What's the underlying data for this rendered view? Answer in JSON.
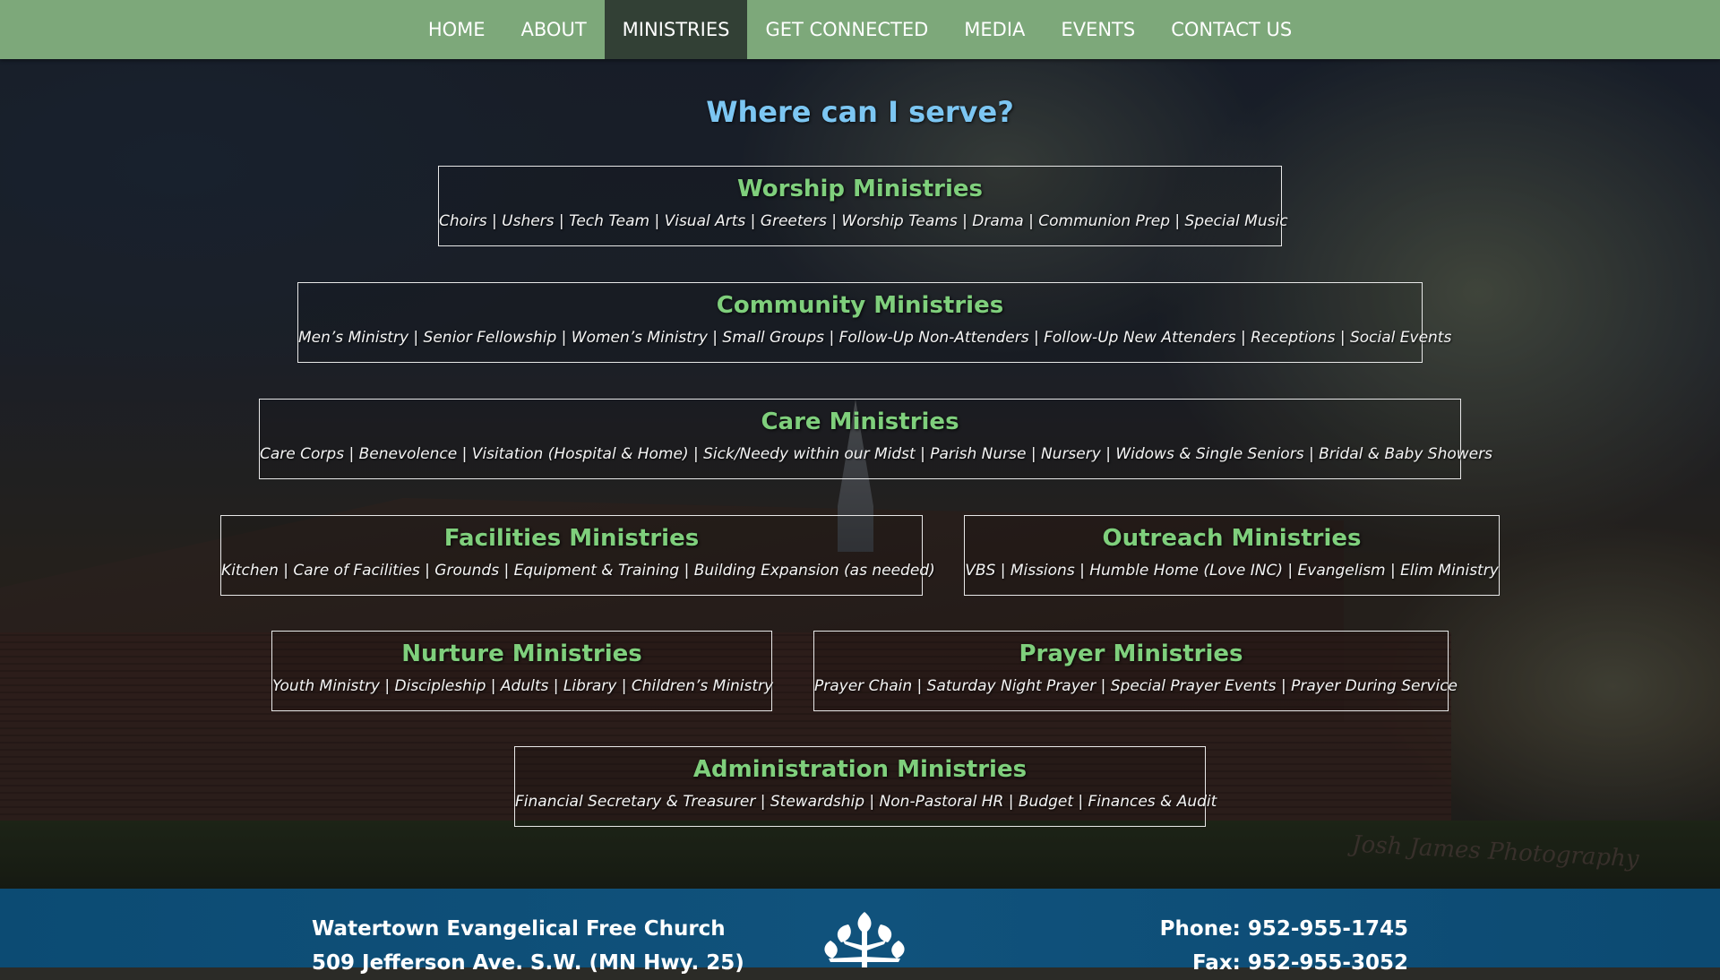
{
  "nav": {
    "items": [
      {
        "label": "HOME"
      },
      {
        "label": "ABOUT"
      },
      {
        "label": "MINISTRIES"
      },
      {
        "label": "GET CONNECTED"
      },
      {
        "label": "MEDIA"
      },
      {
        "label": "EVENTS"
      },
      {
        "label": "CONTACT US"
      }
    ],
    "active": "MINISTRIES"
  },
  "headline": "Where can I serve?",
  "ministries": [
    {
      "title": "Worship Ministries",
      "items": "Choirs | Ushers | Tech Team | Visual Arts | Greeters | Worship Teams | Drama | Communion Prep | Special Music"
    },
    {
      "title": "Community Ministries",
      "items": "Men’s Ministry | Senior Fellowship | Women’s Ministry | Small Groups | Follow-Up Non-Attenders | Follow-Up New Attenders | Receptions | Social Events"
    },
    {
      "title": "Care Ministries",
      "items": "Care Corps | Benevolence | Visitation (Hospital & Home) | Sick/Needy within our Midst | Parish Nurse | Nursery | Widows & Single Seniors | Bridal & Baby Showers"
    },
    {
      "title": "Facilities Ministries",
      "items": "Kitchen | Care of Facilities | Grounds | Equipment & Training | Building Expansion (as needed)"
    },
    {
      "title": "Outreach Ministries",
      "items": "VBS | Missions | Humble Home (Love INC) | Evangelism | Elim Ministry"
    },
    {
      "title": "Nurture Ministries",
      "items": "Youth Ministry | Discipleship | Adults | Library | Children’s Ministry"
    },
    {
      "title": "Prayer Ministries",
      "items": "Prayer Chain | Saturday Night Prayer | Special Prayer Events | Prayer During Service"
    },
    {
      "title": "Administration Ministries",
      "items": "Financial Secretary & Treasurer | Stewardship | Non-Pastoral HR | Budget | Finances & Audit"
    }
  ],
  "background": {
    "watermark": "Josh James Photography"
  },
  "footer": {
    "church_name": "Watertown Evangelical Free Church",
    "address": "509 Jefferson Ave. S.W. (MN Hwy. 25)",
    "phone": "Phone: 952-955-1745",
    "fax": "Fax: 952-955-3052",
    "logo_icon": "tree-logo-icon"
  },
  "colors": {
    "nav_bg": "#7da87a",
    "nav_active": "#324035",
    "headline": "#7cc6f2",
    "section_title": "#7fcf7c",
    "footer_bg": "#0e4f78"
  }
}
